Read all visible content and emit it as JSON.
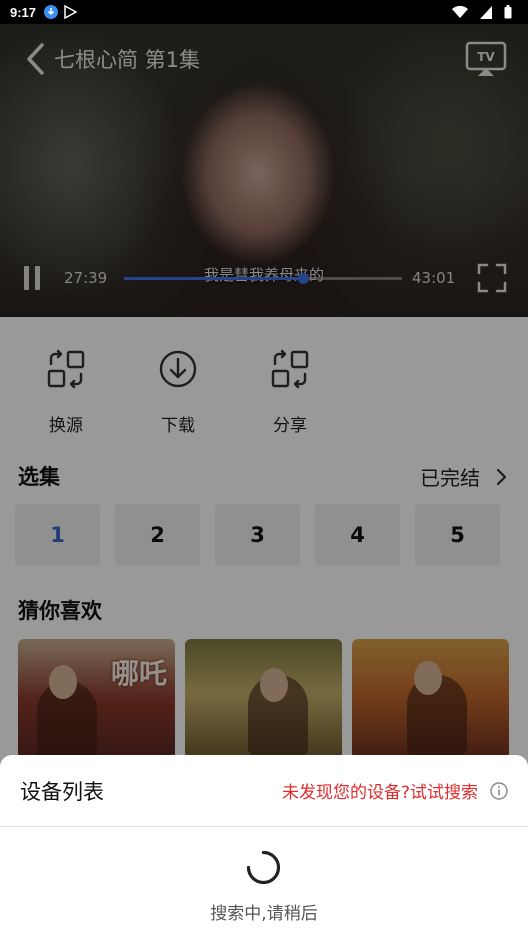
{
  "status_bar": {
    "time": "9:17"
  },
  "player": {
    "title": "七根心简 第1集",
    "subtitle": "我是彗我养母来的",
    "current_time": "27:39",
    "duration": "43:01",
    "progress": 0.643
  },
  "actions": [
    {
      "label": "换源",
      "icon": "swap-source-icon"
    },
    {
      "label": "下载",
      "icon": "download-icon"
    },
    {
      "label": "分享",
      "icon": "share-icon"
    }
  ],
  "episodes": {
    "title": "选集",
    "status": "已完结",
    "items": [
      "1",
      "2",
      "3",
      "4",
      "5"
    ],
    "selected": "1"
  },
  "recommendations": {
    "title": "猜你喜欢",
    "posters": [
      {
        "text": "哪吒"
      },
      {
        "text": ""
      },
      {
        "text": ""
      }
    ]
  },
  "device_sheet": {
    "title": "设备列表",
    "search_link": "未发现您的设备?试试搜索",
    "status": "搜索中,请稍后"
  },
  "colors": {
    "accent_blue": "#3c73e6",
    "selected_episode": "#3a64c6",
    "link_red": "#e02c2c"
  }
}
